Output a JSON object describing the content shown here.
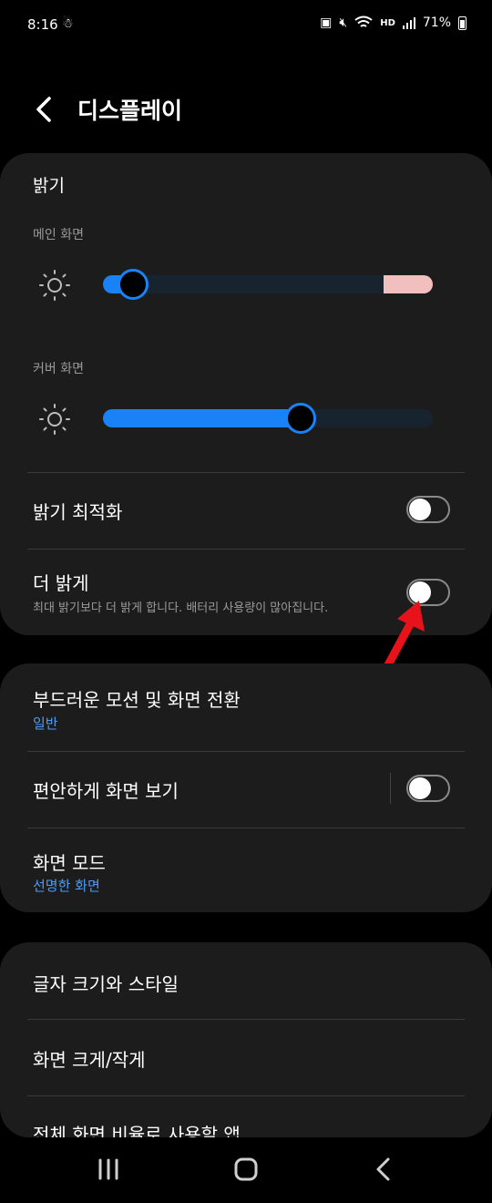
{
  "status_bar": {
    "time": "8:16",
    "left_icon": "app-notification-icon",
    "battery_percent": "71%",
    "icons": [
      "battery-saver-icon",
      "mute-icon",
      "wifi-icon",
      "hd-voice-icon",
      "signal-icon",
      "battery-icon"
    ],
    "hd_voice_label": "HD"
  },
  "header": {
    "back_icon": "chevron-left-icon",
    "title": "디스플레이"
  },
  "brightness": {
    "title": "밝기",
    "main_screen": {
      "label": "메인 화면",
      "level": 0.09,
      "extra_bright_range_start": 0.85
    },
    "cover_screen": {
      "label": "커버 화면",
      "level": 0.6
    }
  },
  "adaptive_brightness": {
    "title": "밝기 최적화",
    "enabled": false
  },
  "extra_brightness": {
    "title": "더 밝게",
    "description": "최대 밝기보다 더 밝게 합니다. 배터리 사용량이 많아집니다.",
    "enabled": false
  },
  "motion_smoothness": {
    "title": "부드러운 모션 및 화면 전환",
    "value": "일반"
  },
  "eye_comfort": {
    "title": "편안하게 화면 보기",
    "enabled": false
  },
  "screen_mode": {
    "title": "화면 모드",
    "value": "선명한 화면"
  },
  "font_size_style": {
    "title": "글자 크기와 스타일"
  },
  "screen_zoom": {
    "title": "화면 크게/작게"
  },
  "full_screen_apps": {
    "title": "전체 화면 비율로 사용할 앱"
  },
  "nav_bar": {
    "icons": [
      "recents-icon",
      "home-icon",
      "back-icon"
    ]
  },
  "colors": {
    "accent": "#1a82f7",
    "link": "#4a9cf5",
    "annotation_arrow": "#e8121a",
    "extra_range": "#f2bfbf"
  }
}
